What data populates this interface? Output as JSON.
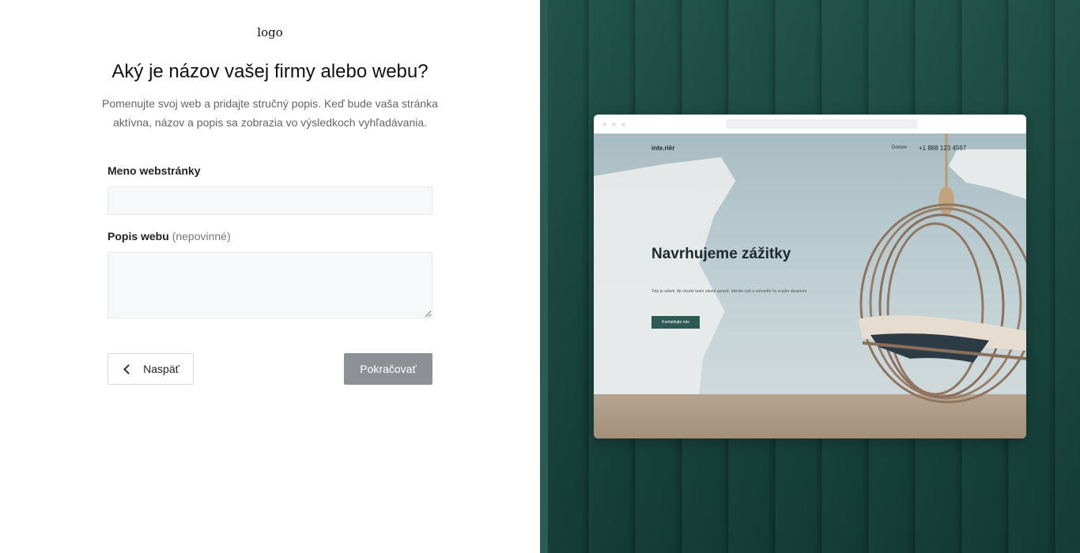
{
  "logo": "logo",
  "title": "Aký je názov vašej firmy alebo webu?",
  "subtitle": "Pomenujte svoj web a pridajte stručný popis. Keď bude vaša stránka aktívna, názov a popis sa zobrazia vo výsledkoch vyhľadávania.",
  "form": {
    "name_label": "Meno webstránky",
    "name_value": "",
    "desc_label": "Popis webu",
    "desc_optional": "(nepovinné)",
    "desc_value": ""
  },
  "buttons": {
    "back": "Naspäť",
    "next": "Pokračovať"
  },
  "preview": {
    "site_logo": "inte.riér",
    "nav_home": "Domov",
    "phone": "+1 888 123 4567",
    "headline": "Navrhujeme zážitky",
    "text": "Toto je odsek. Ak chcete tento odsek upraviť, kliknite naň a nahraďte ho svojím obsahom.",
    "cta": "Kontaktujte nás"
  },
  "colors": {
    "wall": "#1b4841",
    "next_button": "#8d9196",
    "cta": "#2e5a55"
  }
}
